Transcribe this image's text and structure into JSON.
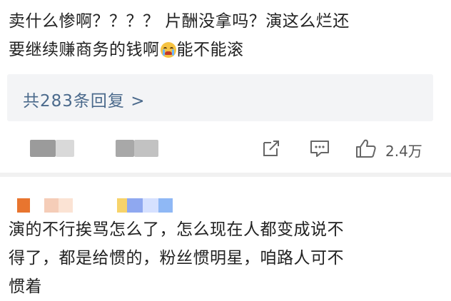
{
  "comment1": {
    "line1": "卖什么惨啊？？？？ 片酬没拿吗？演这么烂还",
    "line2_before": "要继续赚商务的钱啊",
    "line2_emoji": "crying-face-icon",
    "line2_after": "能不能滚"
  },
  "replies": {
    "label": "共283条回复 >"
  },
  "actions": {
    "share_icon": "share-icon",
    "comment_icon": "comment-icon",
    "like_icon": "thumbs-up-icon",
    "like_count": "2.4万"
  },
  "comment2": {
    "line1": "演的不行挨骂怎么了，怎么现在人都变成说不",
    "line2": "得了，都是给惯的，粉丝惯明星，咱路人可不",
    "line3": "惯着"
  },
  "colors": {
    "text": "#222222",
    "reply_link": "#4b6a8c",
    "reply_bg": "#f3f4f6",
    "icon": "#666666"
  }
}
